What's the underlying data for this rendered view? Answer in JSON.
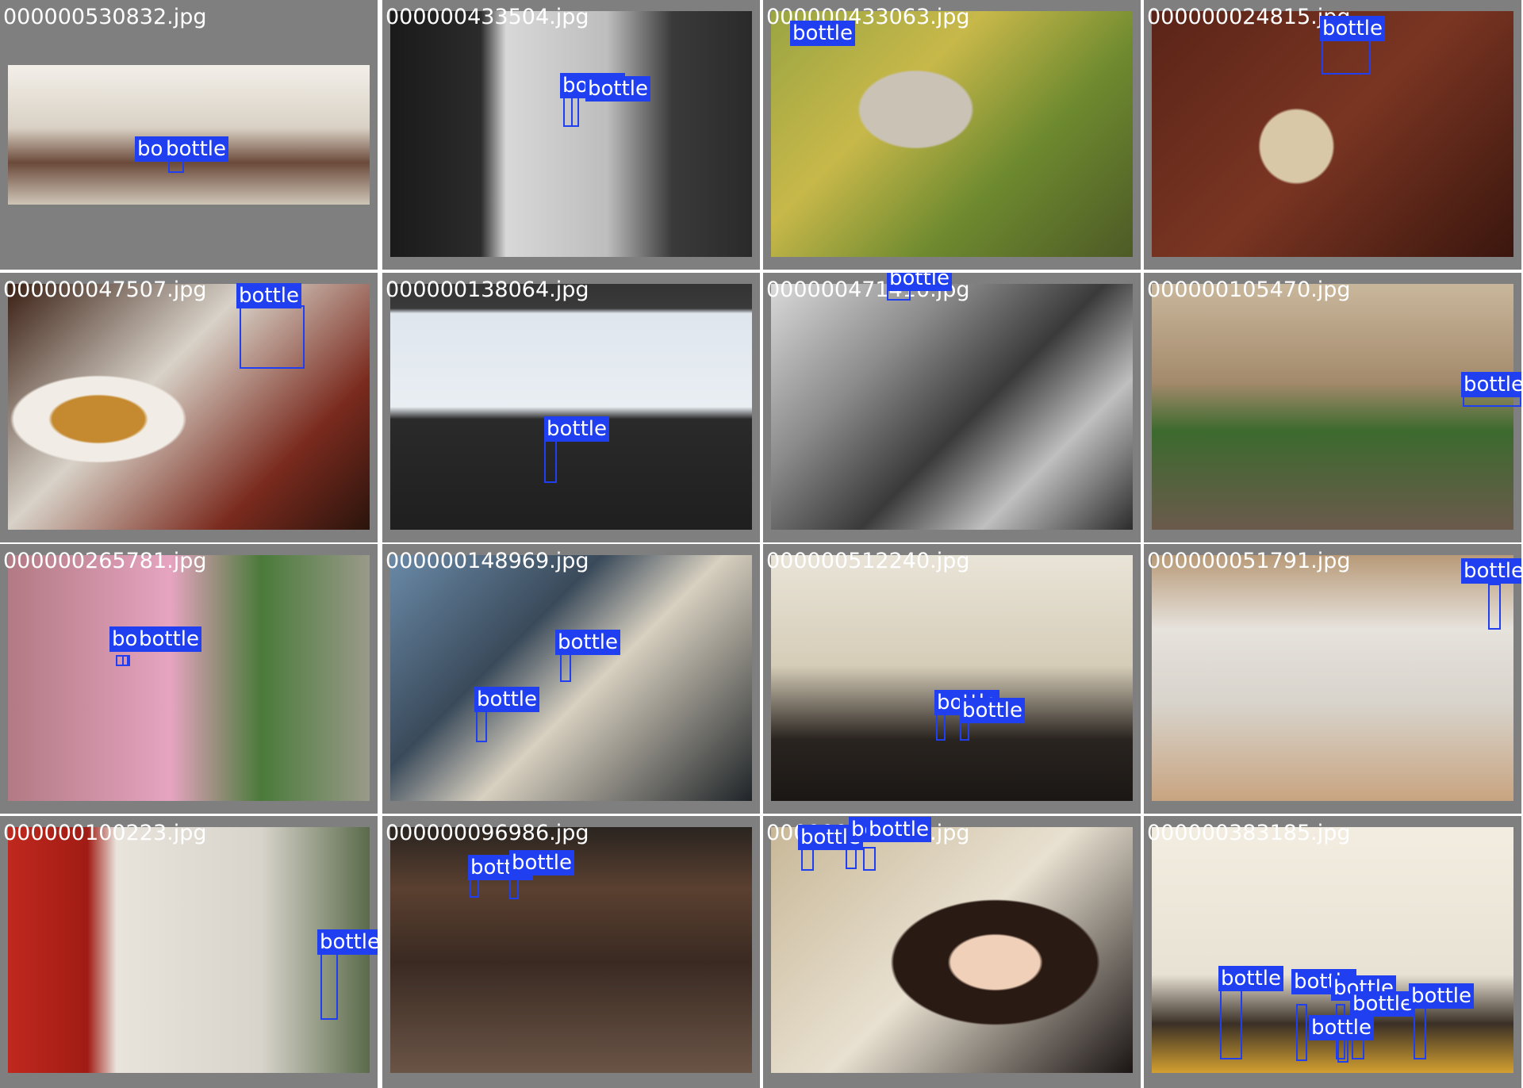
{
  "tiles": [
    {
      "filename": "000000530832.jpg",
      "labels": [
        "bottle",
        "bottle"
      ]
    },
    {
      "filename": "000000433504.jpg",
      "labels": [
        "bottle",
        "bottle"
      ]
    },
    {
      "filename": "000000433063.jpg",
      "labels": [
        "bottle"
      ]
    },
    {
      "filename": "000000024815.jpg",
      "labels": [
        "bottle"
      ]
    },
    {
      "filename": "000000047507.jpg",
      "labels": [
        "bottle"
      ]
    },
    {
      "filename": "000000138064.jpg",
      "labels": [
        "bottle"
      ]
    },
    {
      "filename": "000000471410.jpg",
      "labels": [
        "bottle"
      ]
    },
    {
      "filename": "000000105470.jpg",
      "labels": [
        "bottle"
      ]
    },
    {
      "filename": "000000265781.jpg",
      "labels": [
        "bottle",
        "bottle"
      ]
    },
    {
      "filename": "000000148969.jpg",
      "labels": [
        "bottle",
        "bottle"
      ]
    },
    {
      "filename": "000000512240.jpg",
      "labels": [
        "bottle",
        "bottle"
      ]
    },
    {
      "filename": "000000051791.jpg",
      "labels": [
        "bottle"
      ]
    },
    {
      "filename": "000000100223.jpg",
      "labels": [
        "bottle"
      ]
    },
    {
      "filename": "000000096986.jpg",
      "labels": [
        "bottle",
        "bottle"
      ]
    },
    {
      "filename": "000000373061.jpg",
      "labels": [
        "bottle",
        "bottle",
        "bottle"
      ]
    },
    {
      "filename": "000000383185.jpg",
      "labels": [
        "bottle",
        "bottle",
        "bottle",
        "bottle",
        "bottle",
        "bottle"
      ]
    }
  ],
  "colors": {
    "box": "#1f3ff0",
    "tile_bg": "#7f7f7f",
    "text": "#ffffff"
  }
}
